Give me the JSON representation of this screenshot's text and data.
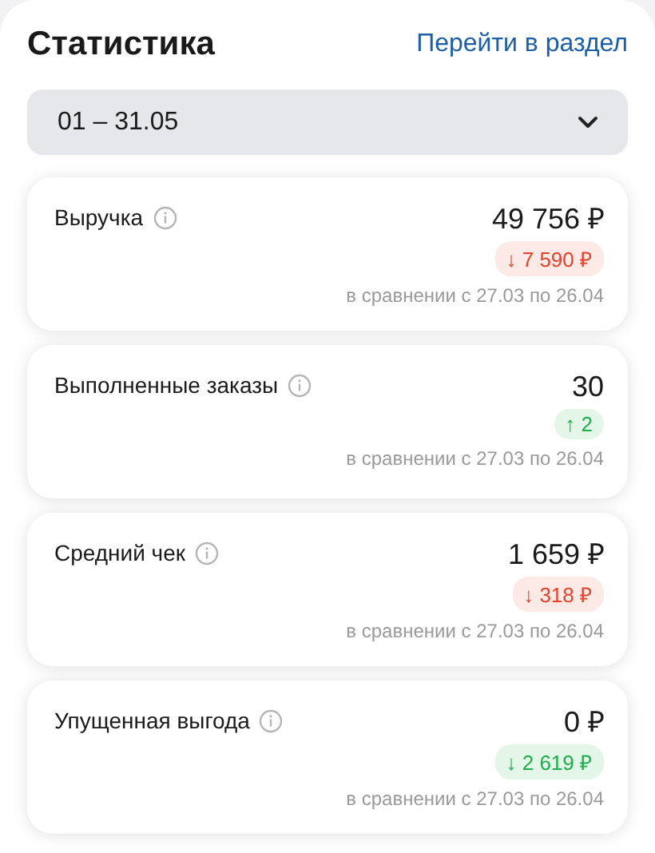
{
  "header": {
    "title": "Статистика",
    "link": "Перейти в раздел"
  },
  "period": {
    "value": "01 – 31.05"
  },
  "metrics": [
    {
      "name": "Выручка",
      "value": "49 756 ₽",
      "delta": "↓ 7 590 ₽",
      "positive": false,
      "comparison": "в сравнении с 27.03 по 26.04"
    },
    {
      "name": "Выполненные заказы",
      "value": "30",
      "delta": "↑ 2",
      "positive": true,
      "comparison": "в сравнении с 27.03 по 26.04"
    },
    {
      "name": "Средний чек",
      "value": "1 659 ₽",
      "delta": "↓ 318 ₽",
      "positive": false,
      "comparison": "в сравнении с 27.03 по 26.04"
    },
    {
      "name": "Упущенная выгода",
      "value": "0 ₽",
      "delta": "↓ 2 619 ₽",
      "positive": true,
      "comparison": "в сравнении с 27.03 по 26.04"
    }
  ]
}
